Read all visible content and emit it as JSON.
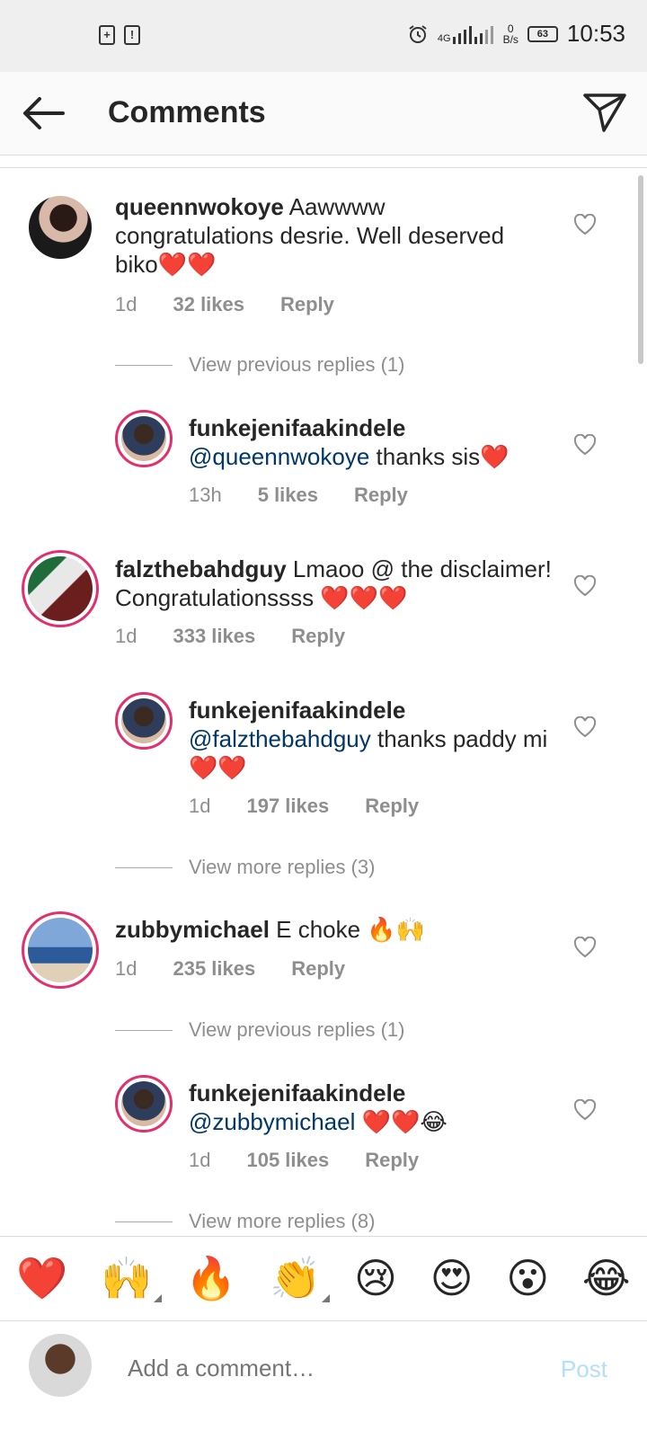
{
  "status": {
    "network": "4G",
    "speed_value": "0",
    "speed_unit": "B/s",
    "battery": "63",
    "time": "10:53"
  },
  "header": {
    "title": "Comments"
  },
  "comments": [
    {
      "user": "queennwokoye",
      "text": " Aawwww congratulations desrie. Well deserved biko",
      "emoji": "❤️❤️",
      "time": "1d",
      "likes": "32 likes",
      "reply": "Reply"
    },
    {
      "view": "View previous replies (1)"
    },
    {
      "user": "funkejenifaakindele",
      "mention": "@queennwokoye",
      "text": " thanks sis",
      "emoji": "❤️",
      "time": "13h",
      "likes": "5 likes",
      "reply": "Reply"
    },
    {
      "user": "falzthebahdguy",
      "text": " Lmaoo @ the disclaimer! Congratulationssss ",
      "emoji": "❤️❤️❤️",
      "time": "1d",
      "likes": "333 likes",
      "reply": "Reply"
    },
    {
      "user": "funkejenifaakindele",
      "mention": "@falzthebahdguy",
      "text": " thanks paddy mi",
      "emoji": "❤️❤️",
      "time": "1d",
      "likes": "197 likes",
      "reply": "Reply"
    },
    {
      "view": "View more replies (3)"
    },
    {
      "user": "zubbymichael",
      "text": " E choke ",
      "emoji": "🔥🙌",
      "time": "1d",
      "likes": "235 likes",
      "reply": "Reply"
    },
    {
      "view": "View previous replies (1)"
    },
    {
      "user": "funkejenifaakindele",
      "mention": "@zubbymichael",
      "text": " ",
      "emoji": "❤️❤️😂",
      "time": "1d",
      "likes": "105 likes",
      "reply": "Reply"
    },
    {
      "view": "View more replies (8)"
    }
  ],
  "emoji_bar": [
    "❤️",
    "🙌",
    "🔥",
    "👏",
    "😢",
    "😍",
    "😮",
    "😂"
  ],
  "input": {
    "placeholder": "Add a comment…",
    "post": "Post"
  }
}
